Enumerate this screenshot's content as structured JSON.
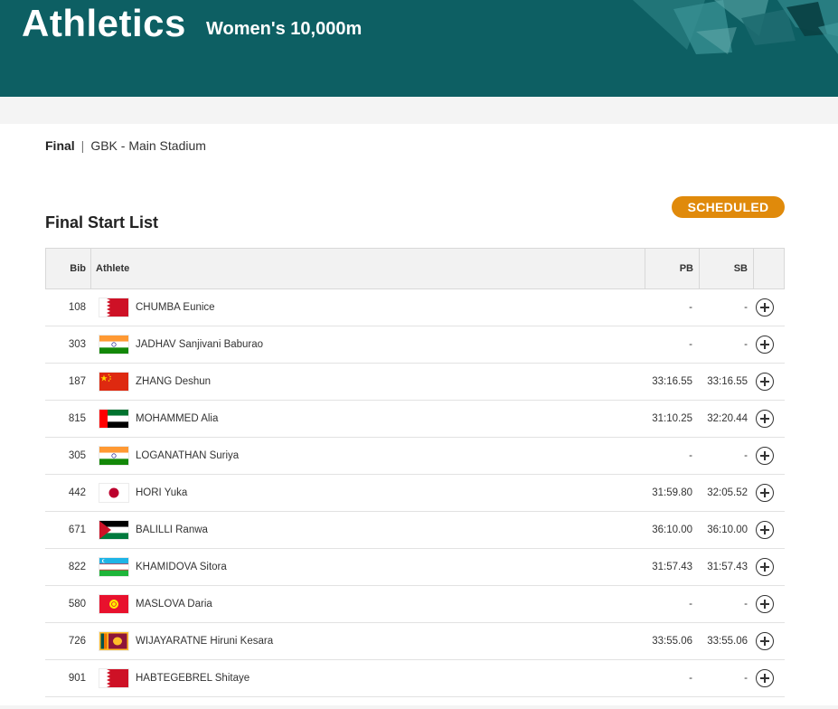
{
  "header": {
    "sport": "Athletics",
    "event": "Women's 10,000m",
    "background_color": "#0d5f63"
  },
  "phase_line": {
    "phase": "Final",
    "separator": "|",
    "venue": "GBK - Main Stadium"
  },
  "status": {
    "label": "SCHEDULED",
    "color": "#e08a0b"
  },
  "start_list": {
    "title": "Final Start List",
    "columns": {
      "bib": "Bib",
      "athlete": "Athlete",
      "pb": "PB",
      "sb": "SB"
    },
    "rows": [
      {
        "bib": "108",
        "flag": "bahrain-flag",
        "name": "CHUMBA Eunice",
        "pb": "-",
        "sb": "-"
      },
      {
        "bib": "303",
        "flag": "india-flag",
        "name": "JADHAV Sanjivani Baburao",
        "pb": "-",
        "sb": "-"
      },
      {
        "bib": "187",
        "flag": "china-flag",
        "name": "ZHANG Deshun",
        "pb": "33:16.55",
        "sb": "33:16.55"
      },
      {
        "bib": "815",
        "flag": "uae-flag",
        "name": "MOHAMMED Alia",
        "pb": "31:10.25",
        "sb": "32:20.44"
      },
      {
        "bib": "305",
        "flag": "india-flag",
        "name": "LOGANATHAN Suriya",
        "pb": "-",
        "sb": "-"
      },
      {
        "bib": "442",
        "flag": "japan-flag",
        "name": "HORI Yuka",
        "pb": "31:59.80",
        "sb": "32:05.52"
      },
      {
        "bib": "671",
        "flag": "palestine-flag",
        "name": "BALILLI Ranwa",
        "pb": "36:10.00",
        "sb": "36:10.00"
      },
      {
        "bib": "822",
        "flag": "uzbekistan-flag",
        "name": "KHAMIDOVA Sitora",
        "pb": "31:57.43",
        "sb": "31:57.43"
      },
      {
        "bib": "580",
        "flag": "kyrgyzstan-flag",
        "name": "MASLOVA Daria",
        "pb": "-",
        "sb": "-"
      },
      {
        "bib": "726",
        "flag": "sri-lanka-flag",
        "name": "WIJAYARATNE Hiruni Kesara",
        "pb": "33:55.06",
        "sb": "33:55.06"
      },
      {
        "bib": "901",
        "flag": "bahrain-flag",
        "name": "HABTEGEBREL Shitaye",
        "pb": "-",
        "sb": "-"
      }
    ],
    "row_action_icon": "plus-circle-icon"
  }
}
